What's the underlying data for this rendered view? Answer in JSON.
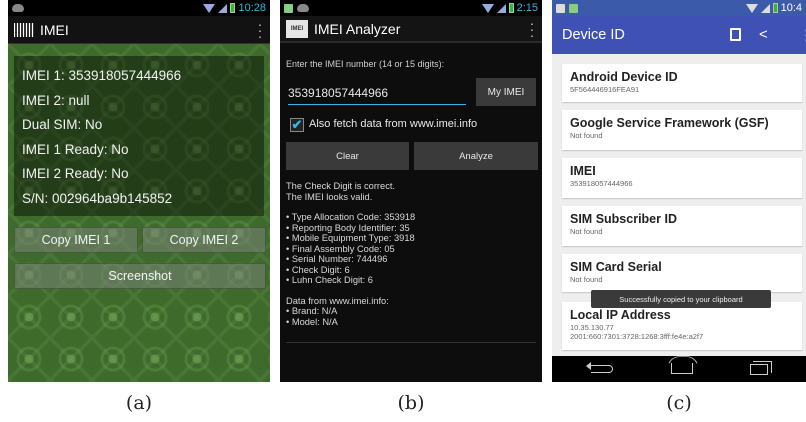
{
  "panel_a": {
    "status": {
      "time": "10:28"
    },
    "title": "IMEI",
    "rows": [
      "IMEI 1: 353918057444966",
      "IMEI 2: null",
      "Dual SIM: No",
      "IMEI 1 Ready: No",
      "IMEI 2 Ready: No",
      "S/N: 002964ba9b145852"
    ],
    "buttons": {
      "copy1": "Copy IMEI 1",
      "copy2": "Copy IMEI 2",
      "screenshot": "Screenshot"
    },
    "caption": "(a)"
  },
  "panel_b": {
    "status": {
      "time": "2:15"
    },
    "logo_text": "IMEI",
    "title": "IMEI Analyzer",
    "hint": "Enter the IMEI number (14 or 15 digits):",
    "imei_value": "353918057444966",
    "my_imei": "My IMEI",
    "fetch_label": "Also fetch data from www.imei.info",
    "clear": "Clear",
    "analyze": "Analyze",
    "result": {
      "line1": "The Check Digit is correct.",
      "line2": "The IMEI looks valid.",
      "bullets": [
        "• Type Allocation Code: 353918",
        "• Reporting Body Identifier: 35",
        "• Mobile Equipment Type: 3918",
        "• Final Assembly Code: 05",
        "• Serial Number: 744496",
        "• Check Digit: 6",
        "• Luhn Check Digit: 6"
      ],
      "info_title": "Data from www.imei.info:",
      "info_bullets": [
        "• Brand: N/A",
        "• Model: N/A"
      ]
    },
    "caption": "(b)"
  },
  "panel_c": {
    "status": {
      "time": "10:4"
    },
    "title": "Device ID",
    "items": [
      {
        "title": "Android Device ID",
        "value": "5F564446916FEA91"
      },
      {
        "title": "Google Service Framework (GSF)",
        "value": "Not found"
      },
      {
        "title": "IMEI",
        "value": "353918057444966"
      },
      {
        "title": "SIM Subscriber ID",
        "value": "Not found"
      },
      {
        "title": "SIM Card Serial",
        "value": "Not found"
      },
      {
        "title": "Local IP Address",
        "value": "10.35.130.77",
        "value2": "2001:660:7301:3728:1268:3fff:fe4e:a2f7"
      }
    ],
    "toast": "Successfully copied to your clipboard",
    "caption": "(c)"
  }
}
